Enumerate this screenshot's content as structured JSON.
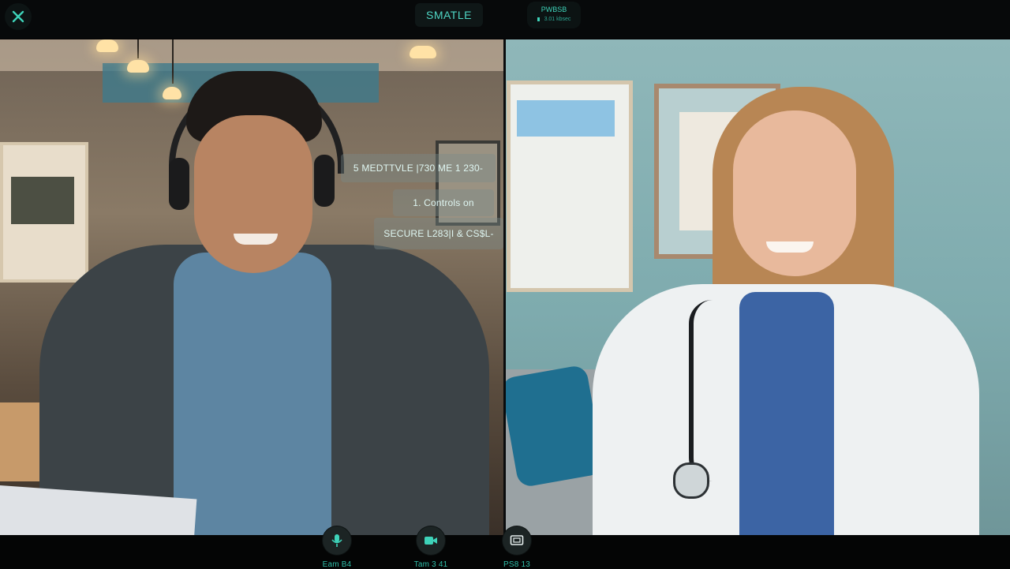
{
  "topbar": {
    "close_icon": "close-x-icon",
    "app_title": "SMATLE",
    "network": {
      "line1": "PWBSB",
      "line2": "3.01 kbsec"
    }
  },
  "overlay": {
    "line1": "5 MEDTTVLE |730 ME 1 230-",
    "line2": "1. Controls on",
    "line3": "SECURE L283|I & CS$L-"
  },
  "controls": [
    {
      "icon": "mic-icon",
      "label": "Eam B4"
    },
    {
      "icon": "video-camera-icon",
      "label": "Tam 3 41"
    },
    {
      "icon": "screen-share-icon",
      "label": "PS8 13"
    }
  ],
  "colors": {
    "accent": "#3ed3b9",
    "bar": "#07090a"
  }
}
